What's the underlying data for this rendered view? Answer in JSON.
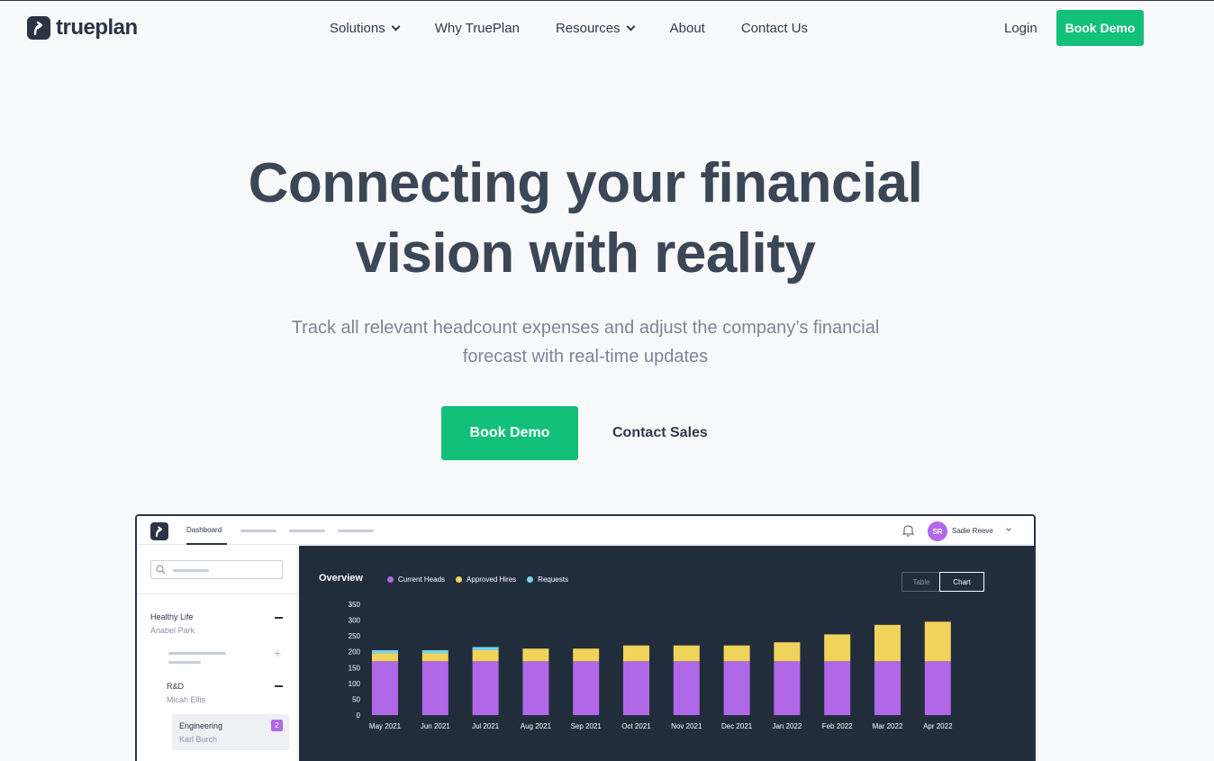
{
  "nav": {
    "brand": "trueplan",
    "links": [
      {
        "label": "Solutions",
        "dropdown": true
      },
      {
        "label": "Why TruePlan",
        "dropdown": false
      },
      {
        "label": "Resources",
        "dropdown": true
      },
      {
        "label": "About",
        "dropdown": false
      },
      {
        "label": "Contact Us",
        "dropdown": false
      }
    ],
    "login": "Login",
    "cta": "Book Demo"
  },
  "hero": {
    "title_line1": "Connecting your financial",
    "title_line2": "vision with reality",
    "subtitle_line1": "Track all relevant headcount expenses and adjust the company’s financial",
    "subtitle_line2": "forecast with real-time updates",
    "primary_button": "Book Demo",
    "secondary_button": "Contact Sales"
  },
  "app": {
    "tab": "Dashboard",
    "user_initials": "SR",
    "user_name": "Sadie Reeve",
    "sidebar": {
      "group": {
        "title": "Healthy Life",
        "owner": "Anabel Park"
      },
      "subgroup": {
        "title": "R&D",
        "owner": "Micah Ellis"
      },
      "selected": {
        "title": "Engineering",
        "owner": "Karl Burch",
        "badge": "2"
      }
    },
    "overview_title": "Overview",
    "view_toggle": {
      "table": "Table",
      "chart": "Chart",
      "selected": "Chart"
    }
  },
  "colors": {
    "brand_green": "#12c07a",
    "dark_navy": "#2b3444",
    "current_heads": "#b068e8",
    "approved_hires": "#f0d35a",
    "requests": "#76d4ea"
  },
  "chart_data": {
    "type": "bar",
    "stacked": true,
    "categories": [
      "May 2021",
      "Jun 2021",
      "Jul 2021",
      "Aug 2021",
      "Sep 2021",
      "Oct 2021",
      "Nov 2021",
      "Dec 2021",
      "Jan 2022",
      "Feb 2022",
      "Mar 2022",
      "Apr 2022"
    ],
    "series": [
      {
        "name": "Current Heads",
        "color": "#b068e8",
        "values": [
          170,
          170,
          170,
          170,
          170,
          170,
          170,
          170,
          170,
          170,
          170,
          170
        ]
      },
      {
        "name": "Approved Hires",
        "color": "#f0d35a",
        "values": [
          25,
          25,
          35,
          40,
          40,
          50,
          50,
          50,
          60,
          85,
          115,
          125
        ]
      },
      {
        "name": "Requests",
        "color": "#76d4ea",
        "values": [
          10,
          10,
          10,
          0,
          0,
          0,
          0,
          0,
          0,
          0,
          0,
          0
        ]
      }
    ],
    "yticks": [
      0,
      50,
      100,
      150,
      200,
      250,
      300,
      350
    ],
    "ylim": [
      0,
      350
    ],
    "legend": "top-left"
  }
}
